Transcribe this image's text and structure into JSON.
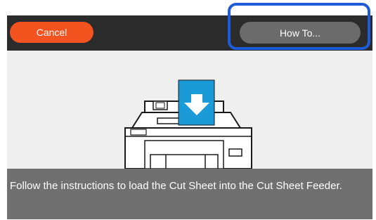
{
  "toolbar": {
    "cancel_label": "Cancel",
    "howto_label": "How To..."
  },
  "message": {
    "text": "Follow the instructions to load the Cut Sheet into the Cut Sheet Feeder."
  },
  "colors": {
    "cancel": "#f2531f",
    "howto": "#6b6b6b",
    "highlight": "#1e5bd8",
    "topbar": "#2b2b2b",
    "message_bg": "#707070",
    "paper": "#1a9ad6"
  },
  "icons": {
    "illustration": "printer-with-cut-sheet",
    "arrow": "arrow-down-icon"
  }
}
